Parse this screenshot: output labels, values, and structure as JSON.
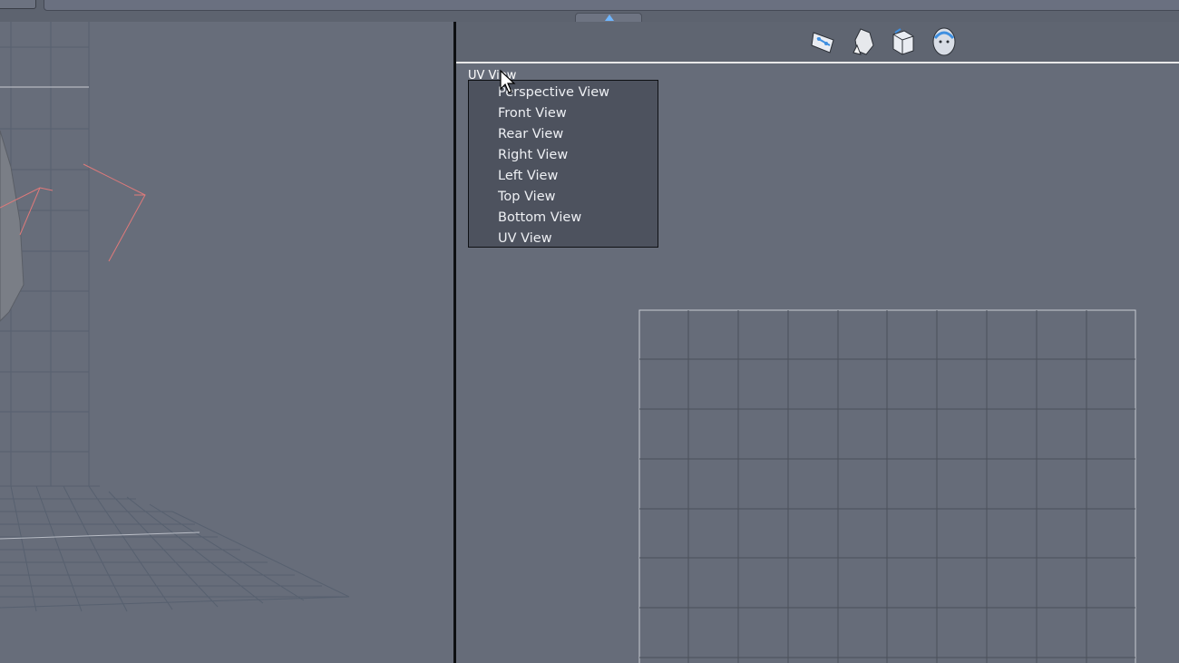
{
  "viewport_right": {
    "current_view_label": "UV View",
    "view_menu": {
      "items": [
        "Perspective View",
        "Front View",
        "Rear View",
        "Right View",
        "Left View",
        "Top View",
        "Bottom View",
        "UV View"
      ]
    },
    "toolbar_icons": [
      "morph-brush-icon",
      "figure-tool-icon",
      "box-tool-icon",
      "head-camera-icon"
    ]
  },
  "colors": {
    "background": "#656b78",
    "menu_bg": "#4d525e",
    "accent": "#6fb6ff",
    "bone_lines": "#e07a7a"
  }
}
